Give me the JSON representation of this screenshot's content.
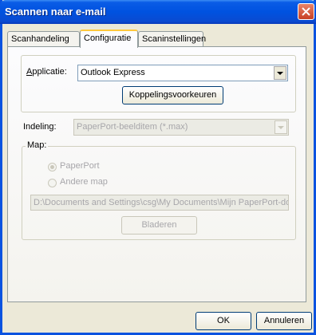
{
  "window": {
    "title": "Scannen naar e-mail"
  },
  "tabs": [
    {
      "label": "Scanhandeling"
    },
    {
      "label": "Configuratie"
    },
    {
      "label": "Scaninstellingen"
    }
  ],
  "application": {
    "label": "Applicatie:",
    "value": "Outlook Express",
    "link_button": "Koppelingsvoorkeuren"
  },
  "format": {
    "label": "Indeling:",
    "value": "PaperPort-beelditem (*.max)"
  },
  "folder": {
    "label": "Map:",
    "option_paperport": "PaperPort",
    "option_other": "Andere map",
    "path": "D:\\Documents and Settings\\csg\\My Documents\\Mijn PaperPort-docu",
    "browse_button": "Bladeren"
  },
  "footer": {
    "ok_button": "OK",
    "cancel_button": "Annuleren"
  }
}
